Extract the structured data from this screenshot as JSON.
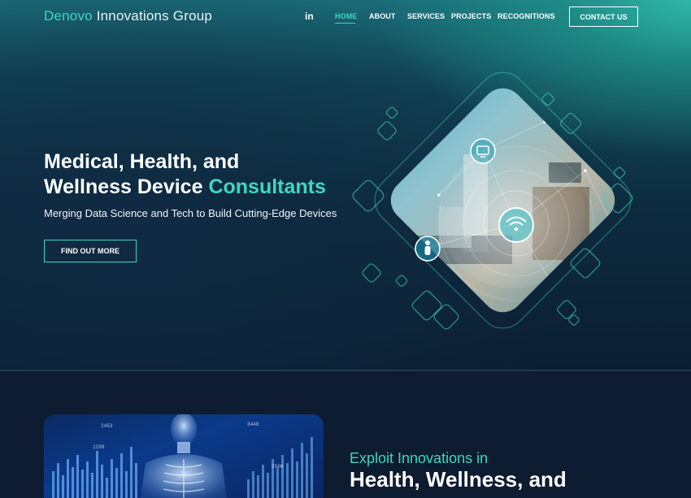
{
  "header": {
    "logo_brand": "Denovo",
    "logo_rest": " Innovations Group",
    "linkedin_label": "in",
    "nav": [
      {
        "label": "HOME",
        "active": true
      },
      {
        "label": "ABOUT"
      },
      {
        "label": "SERVICES"
      },
      {
        "label": "PROJECTS"
      },
      {
        "label": "RECOGNITIONS"
      }
    ],
    "contact_label": "CONTACT US"
  },
  "hero": {
    "title_line1": "Medical, Health, and",
    "title_line2_plain": "Wellness Device ",
    "title_line2_accent": "Consultants",
    "subtitle": "Merging Data Science and Tech to Build Cutting-Edge Devices",
    "cta_label": "FIND OUT MORE",
    "image_icons": [
      "monitor-icon",
      "wifi-icon",
      "person-icon"
    ]
  },
  "section2": {
    "kicker": "Exploit Innovations in",
    "title": "Health, Wellness, and"
  },
  "colors": {
    "accent": "#3fd6bf",
    "background": "#0d1c30",
    "header_glow": "#2fb7a6"
  }
}
